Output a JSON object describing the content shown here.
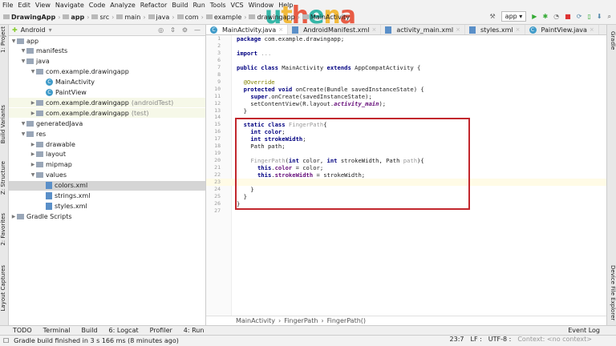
{
  "menu": [
    "File",
    "Edit",
    "View",
    "Navigate",
    "Code",
    "Analyze",
    "Refactor",
    "Build",
    "Run",
    "Tools",
    "VCS",
    "Window",
    "Help"
  ],
  "watermark": "uthena",
  "breadcrumbs": [
    "DrawingApp",
    "app",
    "src",
    "main",
    "java",
    "com",
    "example",
    "drawingapp",
    "MainActivity"
  ],
  "run_config": "app",
  "project": {
    "view": "Android",
    "tree": [
      {
        "label": "app",
        "depth": 0,
        "icon": "folder"
      },
      {
        "label": "manifests",
        "depth": 1,
        "icon": "folder"
      },
      {
        "label": "java",
        "depth": 1,
        "icon": "folder"
      },
      {
        "label": "com.example.drawingapp",
        "depth": 2,
        "icon": "folder"
      },
      {
        "label": "MainActivity",
        "depth": 3,
        "icon": "class"
      },
      {
        "label": "PaintView",
        "depth": 3,
        "icon": "class"
      },
      {
        "label": "com.example.drawingapp",
        "suffix": "(androidTest)",
        "depth": 2,
        "icon": "folder"
      },
      {
        "label": "com.example.drawingapp",
        "suffix": "(test)",
        "depth": 2,
        "icon": "folder"
      },
      {
        "label": "generatedJava",
        "depth": 1,
        "icon": "folder"
      },
      {
        "label": "res",
        "depth": 1,
        "icon": "folder"
      },
      {
        "label": "drawable",
        "depth": 2,
        "icon": "folder"
      },
      {
        "label": "layout",
        "depth": 2,
        "icon": "folder"
      },
      {
        "label": "mipmap",
        "depth": 2,
        "icon": "folder"
      },
      {
        "label": "values",
        "depth": 2,
        "icon": "folder"
      },
      {
        "label": "colors.xml",
        "depth": 3,
        "icon": "xml",
        "selected": true
      },
      {
        "label": "strings.xml",
        "depth": 3,
        "icon": "xml"
      },
      {
        "label": "styles.xml",
        "depth": 3,
        "icon": "xml"
      },
      {
        "label": "Gradle Scripts",
        "depth": 0,
        "icon": "gradle"
      }
    ]
  },
  "left_tabs": [
    "1: Project",
    "Build Variants",
    "Z: Structure",
    "2: Favorites",
    "Layout Captures"
  ],
  "right_tabs": [
    "Gradle",
    "Device File Explorer"
  ],
  "tabs": [
    {
      "label": "MainActivity.java",
      "active": true
    },
    {
      "label": "AndroidManifest.xml"
    },
    {
      "label": "activity_main.xml"
    },
    {
      "label": "styles.xml"
    },
    {
      "label": "PaintView.java"
    }
  ],
  "code": [
    {
      "n": "1",
      "html": "<span class=kw>package</span> com.example.drawingapp;"
    },
    {
      "n": "2",
      "html": ""
    },
    {
      "n": "3",
      "html": "<span class=kw>import</span> <span class=gr>...</span>"
    },
    {
      "n": "6",
      "html": ""
    },
    {
      "n": "7",
      "html": "<span class=kw>public class</span> MainActivity <span class=kw>extends</span> AppCompatActivity {"
    },
    {
      "n": "8",
      "html": ""
    },
    {
      "n": "9",
      "html": "  <span class=an>@Override</span>"
    },
    {
      "n": "10",
      "html": "  <span class=kw>protected void</span> onCreate(Bundle savedInstanceState) {"
    },
    {
      "n": "11",
      "html": "    <span class=kw>super</span>.onCreate(savedInstanceState);"
    },
    {
      "n": "12",
      "html": "    setContentView(R.layout.<span class=it>activity_main</span>);"
    },
    {
      "n": "13",
      "html": "  }"
    },
    {
      "n": "14",
      "html": ""
    },
    {
      "n": "15",
      "html": "  <span class=kw>static class</span> <span class=gr>FingerPath</span>{"
    },
    {
      "n": "16",
      "html": "    <span class=kw>int color</span>;"
    },
    {
      "n": "17",
      "html": "    <span class=kw>int strokeWidth</span>;"
    },
    {
      "n": "18",
      "html": "    Path path;"
    },
    {
      "n": "19",
      "html": ""
    },
    {
      "n": "20",
      "html": "    <span class=gr>FingerPath</span>(<span class=kw>int</span> color, <span class=kw>int</span> strokeWidth, Path <span class=gr>path</span>){"
    },
    {
      "n": "21",
      "html": "      <span class=kw>this</span>.<span class=fld>color</span> = color;"
    },
    {
      "n": "22",
      "html": "      <span class=kw>this</span>.<span class=fld>strokeWidth</span> = strokeWidth;"
    },
    {
      "n": "23",
      "html": "",
      "current": true
    },
    {
      "n": "24",
      "html": "    }"
    },
    {
      "n": "25",
      "html": "  }"
    },
    {
      "n": "26",
      "html": "}"
    },
    {
      "n": "27",
      "html": ""
    }
  ],
  "editor_breadcrumb": [
    "MainActivity",
    "FingerPath",
    "FingerPath()"
  ],
  "bottom_tools": [
    "TODO",
    "Terminal",
    "Build",
    "6: Logcat",
    "Profiler",
    "4: Run"
  ],
  "event_log": "Event Log",
  "status": {
    "message": "Gradle build finished in 3 s 166 ms (8 minutes ago)",
    "position": "23:7",
    "line_sep": "LF :",
    "encoding": "UTF-8 :",
    "context": "Context: <no context>"
  },
  "colors": {
    "highlight_box": "#c2272d",
    "selected_row": "#d5d5d5"
  }
}
